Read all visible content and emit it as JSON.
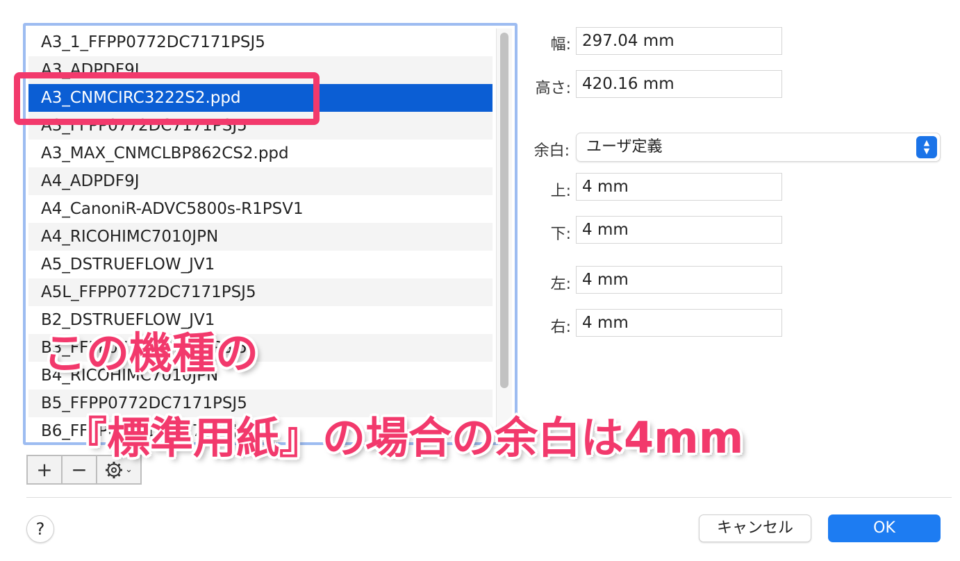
{
  "list": {
    "items": [
      "A3_1_FFPP0772DC7171PSJ5",
      "A3_ADPDF9J",
      "A3_CNMCIRC3222S2.ppd",
      "A3_FFPP0772DC7171PSJ5",
      "A3_MAX_CNMCLBP862CS2.ppd",
      "A4_ADPDF9J",
      "A4_CanoniR-ADVC5800s-R1PSV1",
      "A4_RICOHIMC7010JPN",
      "A5_DSTRUEFLOW_JV1",
      "A5L_FFPP0772DC7171PSJ5",
      "B2_DSTRUEFLOW_JV1",
      "B3_FFPP0772DC7171PSJ5",
      "B4_RICOHIMC7010JPN",
      "B5_FFPP0772DC7171PSJ5",
      "B6_FFPP0772DC7171PSJ5"
    ],
    "selected_index": 2
  },
  "toolbar": {
    "add_label": "+",
    "remove_label": "−",
    "gear_icon": "gear-icon",
    "chevron": "⌄"
  },
  "size": {
    "width_label": "幅:",
    "width_value": "297.04 mm",
    "height_label": "高さ:",
    "height_value": "420.16 mm"
  },
  "margins": {
    "label": "余白:",
    "selected": "ユーザ定義",
    "top_label": "上:",
    "top_value": "4 mm",
    "bottom_label": "下:",
    "bottom_value": "4 mm",
    "left_label": "左:",
    "left_value": "4 mm",
    "right_label": "右:",
    "right_value": "4 mm"
  },
  "footer": {
    "help_label": "?",
    "cancel_label": "キャンセル",
    "ok_label": "OK"
  },
  "annotation": {
    "line1": "この機種の",
    "line2": "『標準用紙』の場合の余白は4mm",
    "color": "#f2396c"
  }
}
